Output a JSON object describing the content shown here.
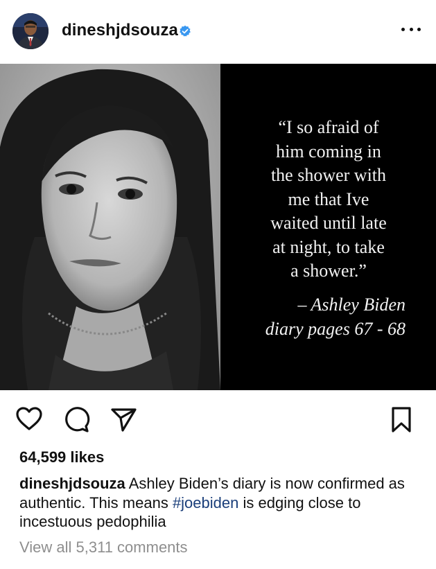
{
  "header": {
    "username": "dineshjdsouza",
    "verified": true,
    "more_icon": "more-horizontal-icon"
  },
  "post_image": {
    "quote_lines": "“I so afraid of\nhim coming in\nthe shower with\nme that Ive\nwaited until late\nat night, to take\na shower.”",
    "attribution_name": "– Ashley Biden",
    "attribution_source": "diary pages 67 - 68"
  },
  "actions": {
    "icons": [
      "heart-icon",
      "comment-icon",
      "share-icon",
      "bookmark-icon"
    ]
  },
  "likes": "64,599 likes",
  "caption": {
    "username": "dineshjdsouza",
    "text_before": " Ashley Biden’s diary is now confirmed as authentic. This means ",
    "hashtag": "#joebiden",
    "text_after": " is edging close to incestuous pedophilia"
  },
  "view_comments": "View all 5,311 comments",
  "colors": {
    "verified_blue": "#3897f0",
    "hashtag": "#1a3e7a",
    "muted": "#8e8e8e"
  }
}
